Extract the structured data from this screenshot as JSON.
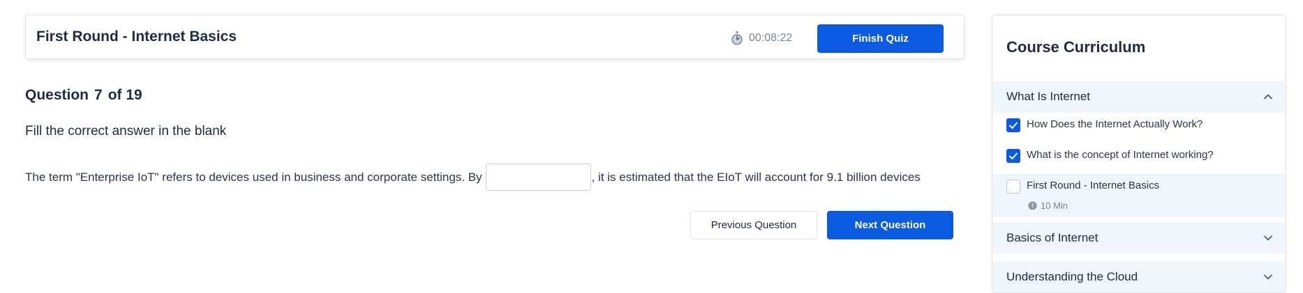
{
  "quiz": {
    "title": "First Round - Internet Basics",
    "timer": "00:08:22",
    "finish_label": "Finish Quiz"
  },
  "question": {
    "prefix": "Question",
    "number": "7",
    "of_label": "of 19",
    "instruction": "Fill the correct answer in the blank",
    "text_before": "The term \"Enterprise IoT\" refers to devices used in business and corporate settings. By",
    "text_after": ", it is estimated that the EIoT will account for 9.1 billion devices",
    "blank_value": ""
  },
  "nav": {
    "previous_label": "Previous Question",
    "next_label": "Next Question"
  },
  "sidebar": {
    "title": "Course Curriculum",
    "sections": [
      {
        "label": "What Is Internet",
        "expanded": true,
        "lessons": [
          {
            "label": "How Does the Internet Actually Work?",
            "checked": true
          },
          {
            "label": "What is the concept of Internet working?",
            "checked": true
          },
          {
            "label": "First Round - Internet Basics",
            "checked": false,
            "active": true,
            "meta": "10 Min"
          }
        ]
      },
      {
        "label": "Basics of Internet",
        "expanded": false
      },
      {
        "label": "Understanding the Cloud",
        "expanded": false
      }
    ]
  },
  "colors": {
    "accent": "#0a5be0",
    "section_bg": "#f1f5fc",
    "text": "#1f2a44",
    "muted": "#7b8494"
  }
}
